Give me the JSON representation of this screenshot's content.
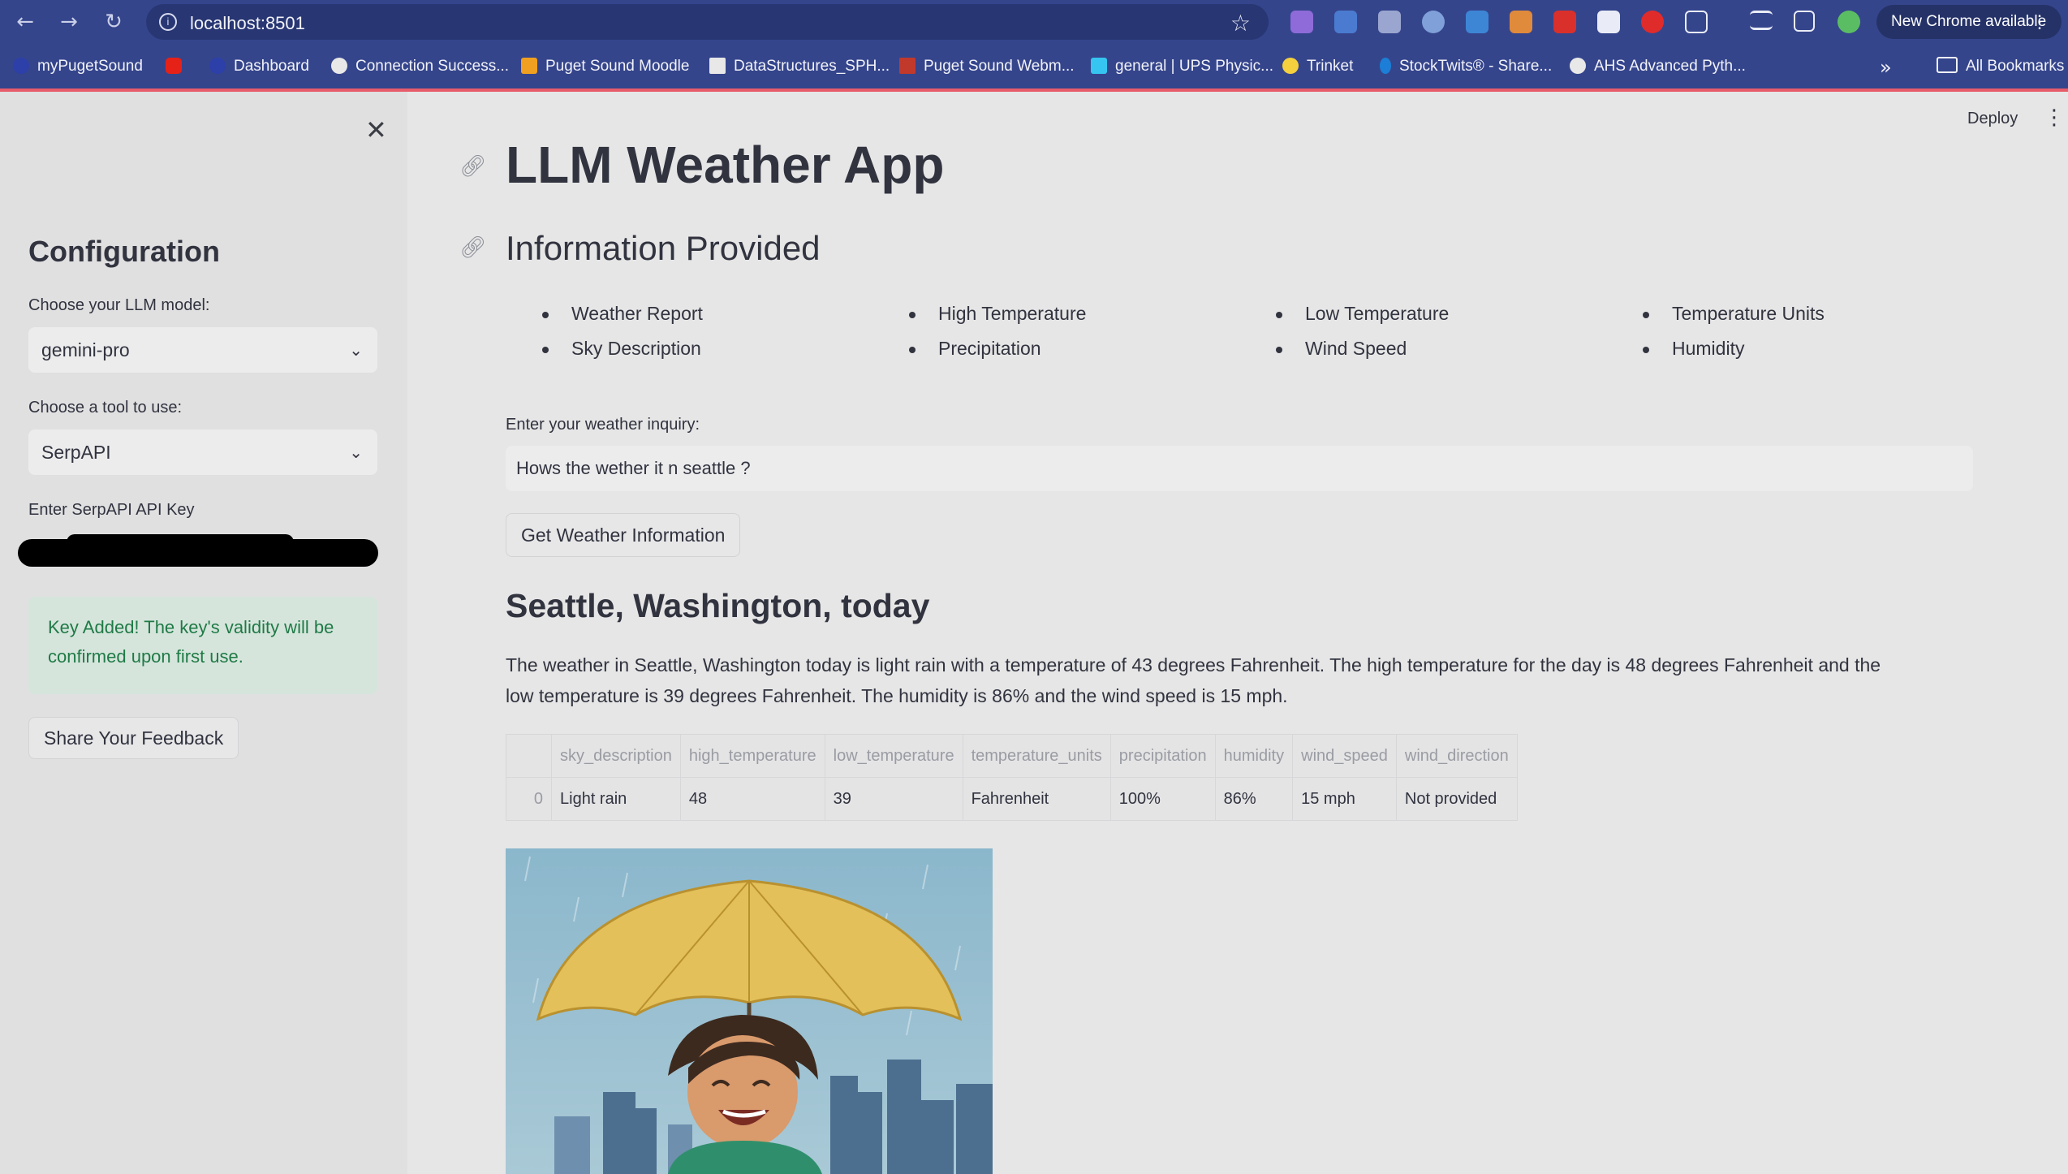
{
  "browser": {
    "url": "localhost:8501",
    "update_button": "New Chrome available",
    "bookmarks": [
      {
        "label": "myPugetSound",
        "color": "#2d3fa8"
      },
      {
        "label": "",
        "color": "#e62117"
      },
      {
        "label": "Dashboard",
        "color": "#2d3fa8"
      },
      {
        "label": "Connection Success...",
        "color": "#e8e8e8"
      },
      {
        "label": "Puget Sound Moodle",
        "color": "#f0a020"
      },
      {
        "label": "DataStructures_SPH...",
        "color": "#e8e8e8"
      },
      {
        "label": "Puget Sound Webm...",
        "color": "#c0392b"
      },
      {
        "label": "general | UPS Physic...",
        "color": "#36c5f0"
      },
      {
        "label": "Trinket",
        "color": "#f4d03f"
      },
      {
        "label": "StockTwits® - Share...",
        "color": "#1c7ed6"
      },
      {
        "label": "AHS Advanced Pyth...",
        "color": "#e8e8e8"
      }
    ],
    "all_bookmarks": "All Bookmarks"
  },
  "sidebar": {
    "title": "Configuration",
    "model_label": "Choose your LLM model:",
    "model_value": "gemini-pro",
    "tool_label": "Choose a tool to use:",
    "tool_value": "SerpAPI",
    "api_key_label": "Enter SerpAPI API Key",
    "success_message": "Key Added! The key's validity will be confirmed upon first use.",
    "feedback_button": "Share Your Feedback"
  },
  "header": {
    "deploy": "Deploy"
  },
  "main": {
    "title": "LLM Weather App",
    "info_title": "Information Provided",
    "info_items": [
      "Weather Report",
      "Sky Description",
      "High Temperature",
      "Precipitation",
      "Low Temperature",
      "Wind Speed",
      "Temperature Units",
      "Humidity"
    ],
    "inquiry_label": "Enter your weather inquiry:",
    "inquiry_value": "Hows the wether it n seattle ?",
    "get_button": "Get Weather Information",
    "result_title": "Seattle, Washington, today",
    "result_text": "The weather in Seattle, Washington today is light rain with a temperature of 43 degrees Fahrenheit. The high temperature for the day is 48 degrees Fahrenheit and the low temperature is 39 degrees Fahrenheit. The humidity is 86% and the wind speed is 15 mph.",
    "table": {
      "columns": [
        "",
        "sky_description",
        "high_temperature",
        "low_temperature",
        "temperature_units",
        "precipitation",
        "humidity",
        "wind_speed",
        "wind_direction"
      ],
      "rows": [
        [
          "0",
          "Light rain",
          "48",
          "39",
          "Fahrenheit",
          "100%",
          "86%",
          "15 mph",
          "Not provided"
        ]
      ]
    }
  },
  "colors": {
    "browser_bar": "#35458c",
    "sidebar_bg": "#e0e0e1",
    "main_bg": "#e6e6e6",
    "success_text": "#1f7a46",
    "umbrella": "#e3c05a"
  },
  "icons": [
    "back-arrow-icon",
    "forward-arrow-icon",
    "reload-icon",
    "info-icon",
    "star-icon",
    "close-icon",
    "chevron-down-icon",
    "link-icon",
    "more-vert-icon"
  ]
}
